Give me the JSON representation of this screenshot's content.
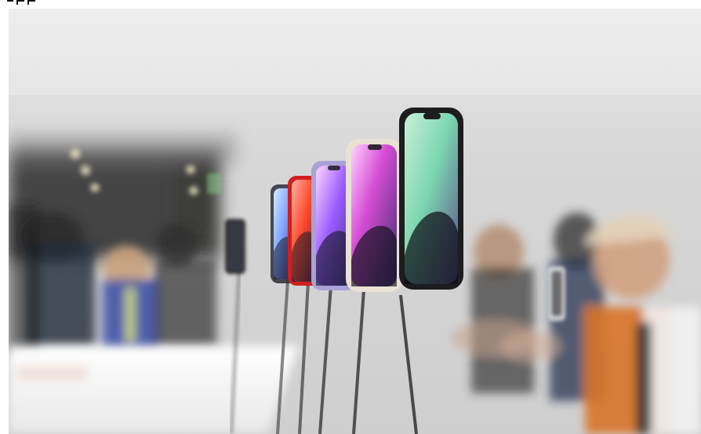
{
  "image": {
    "subject": "smartphones-on-display-stands",
    "colors": {
      "wall": "#d8d8d8",
      "ceiling": "#cfcfcf",
      "doorway": "#2b2a28",
      "table": "#f1f1f1",
      "phone_frame": "#1d1d1f",
      "phone_midnight": "#2b2e3b",
      "phone_red": "#d11f1f",
      "phone_purple": "#a9a2d8",
      "phone_starlight": "#e9e1d5",
      "phone_blue": "#7fa6d8",
      "stand": "#3a3a3a",
      "cap": "#e3d2ba",
      "jacket": "#d9742a",
      "shirt": "#f3f3f3",
      "lanyard": "#d7e86b"
    }
  }
}
